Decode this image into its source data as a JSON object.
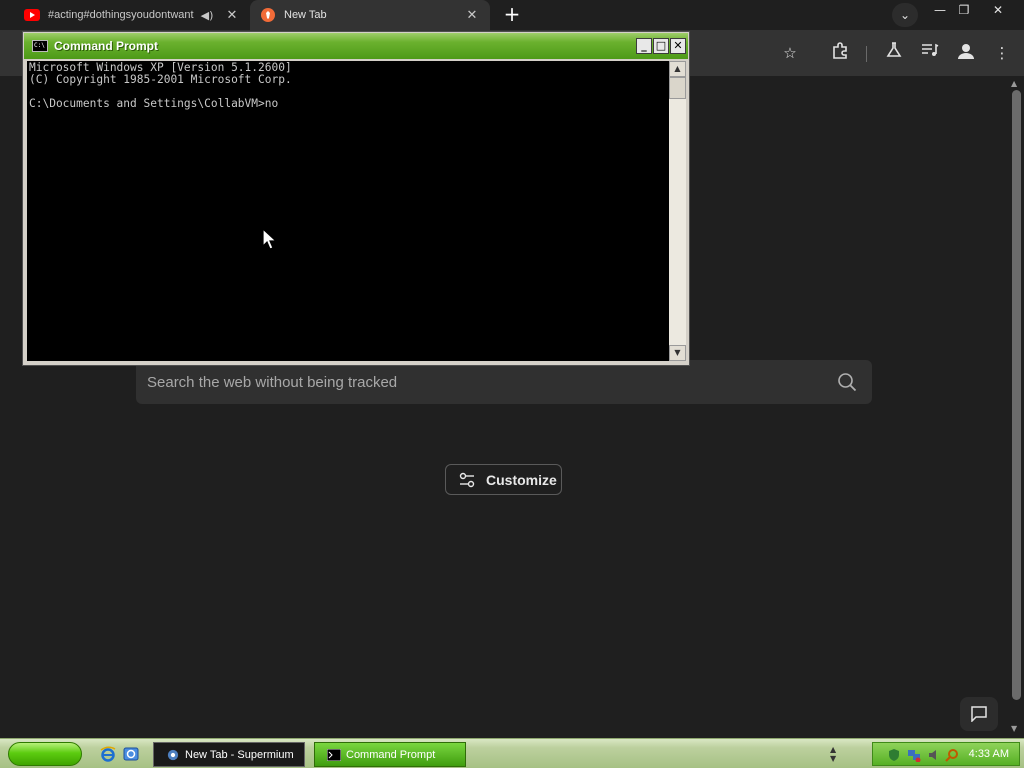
{
  "browser": {
    "tabs": [
      {
        "title": "#acting#dothingsyoudontwant",
        "favicon": "youtube-icon",
        "audio": true
      },
      {
        "title": "New Tab",
        "favicon": "brave-icon",
        "active": true
      }
    ],
    "toolbar_icons": [
      "star-icon",
      "extensions-icon",
      "labs-icon",
      "media-controls-icon",
      "profile-icon",
      "menu-icon"
    ]
  },
  "page": {
    "search_placeholder": "Search the web without being tracked",
    "customize_label": "Customize"
  },
  "cmd": {
    "title": "Command Prompt",
    "lines": [
      "Microsoft Windows XP [Version 5.1.2600]",
      "(C) Copyright 1985-2001 Microsoft Corp.",
      "",
      "C:\\Documents and Settings\\CollabVM>no"
    ]
  },
  "taskbar": {
    "tasks": [
      {
        "label": "New Tab - Supermium",
        "active": false
      },
      {
        "label": "Command Prompt",
        "active": true
      }
    ],
    "clock": "4:33 AM"
  },
  "colors": {
    "browser_bg": "#1f1f1f",
    "toolbar_bg": "#333333",
    "xp_green_titlebar": "#4d9a18",
    "taskbar_bg": "#bcd09e"
  }
}
